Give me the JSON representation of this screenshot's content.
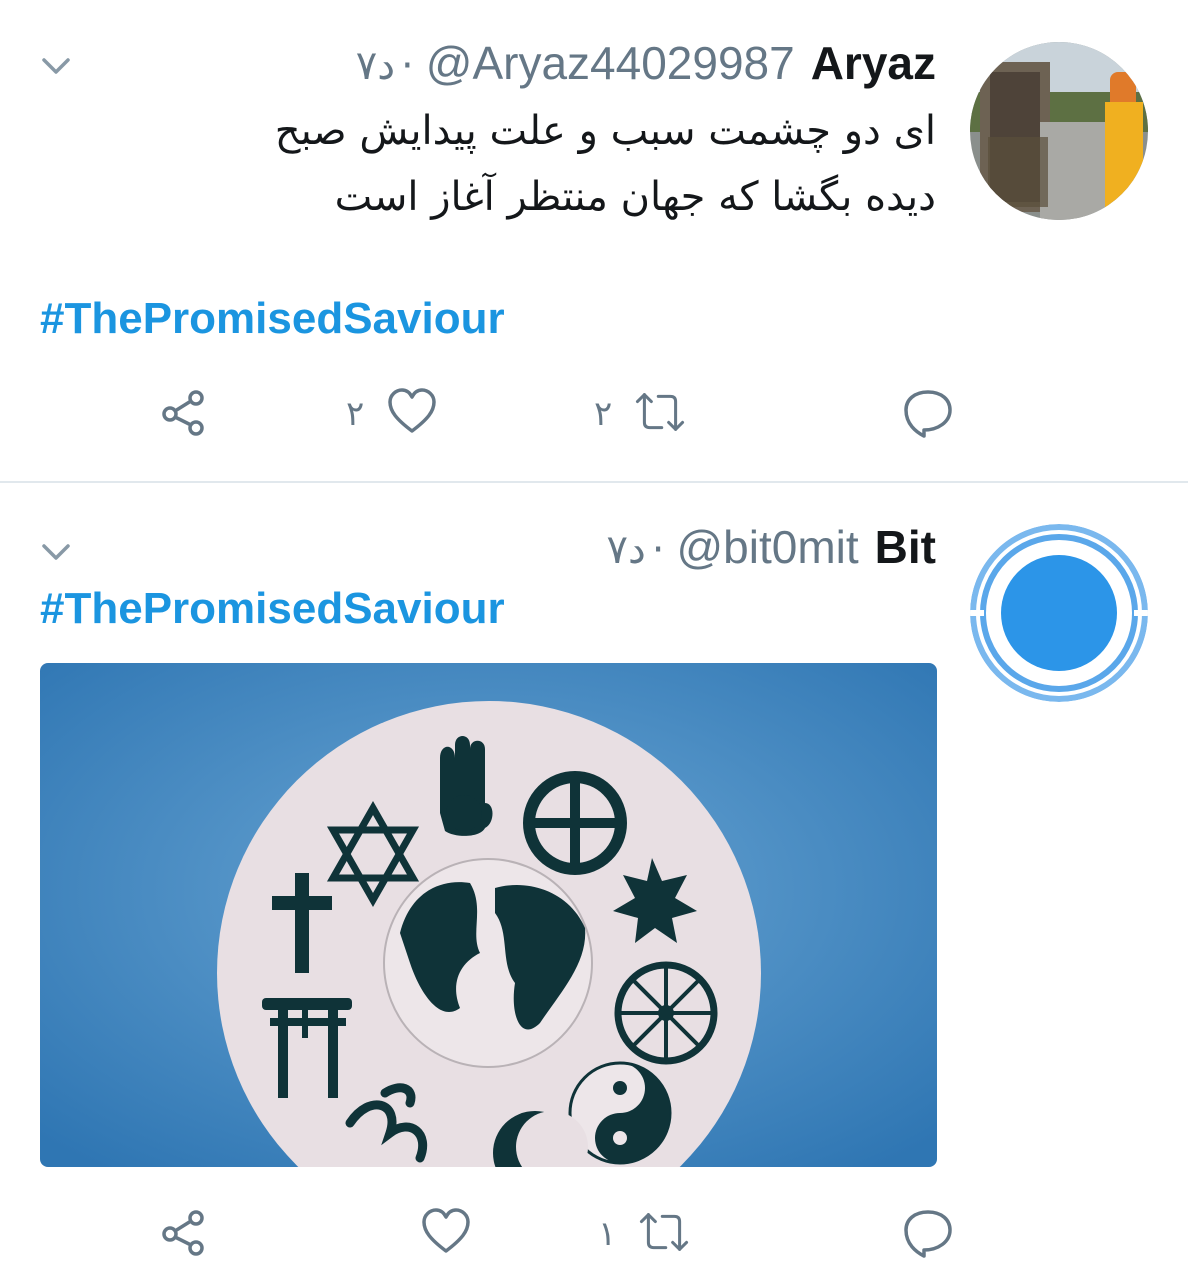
{
  "colors": {
    "accent": "#1b95e0",
    "secondary_text": "#657786",
    "primary_text": "#14171a",
    "divider": "#e1e8ed",
    "media_blue": "#3c82bd"
  },
  "tweets": [
    {
      "display_name": "Aryaz",
      "handle": "@Aryaz44029987",
      "separator": "·",
      "timestamp": "۷د",
      "text_lines": [
        "ای دو چشمت سبب و علت پیدایش صبح",
        "دیده بگشا که جهان منتظر آغاز است"
      ],
      "hashtag": "#ThePromisedSaviour",
      "reply_count": "",
      "retweet_count": "۲",
      "like_count": "۲",
      "icons": [
        "chevron-down-icon",
        "reply-icon",
        "retweet-icon",
        "like-icon",
        "share-icon"
      ]
    },
    {
      "display_name": "Bit",
      "handle": "@bit0mit",
      "separator": "·",
      "timestamp": "۷د",
      "hashtag": "#ThePromisedSaviour",
      "media": "world religions symbols around a globe",
      "reply_count": "",
      "retweet_count": "۱",
      "like_count": "",
      "icons": [
        "chevron-down-icon",
        "reply-icon",
        "retweet-icon",
        "like-icon",
        "share-icon"
      ]
    }
  ]
}
